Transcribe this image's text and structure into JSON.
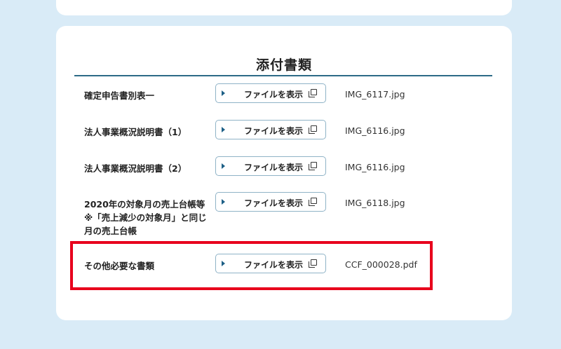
{
  "section": {
    "title": "添付書類"
  },
  "rows": [
    {
      "label": "確定申告書別表一",
      "button": "ファイルを表示",
      "file": "IMG_6117.jpg"
    },
    {
      "label": "法人事業概況説明書（1）",
      "button": "ファイルを表示",
      "file": "IMG_6116.jpg"
    },
    {
      "label": "法人事業概況説明書（2）",
      "button": "ファイルを表示",
      "file": "IMG_6116.jpg"
    },
    {
      "label_lines": [
        "2020年の対象月の売上台帳等",
        "※「売上減少の対象月」と同じ",
        "月の売上台帳"
      ],
      "button": "ファイルを表示",
      "file": "IMG_6118.jpg"
    },
    {
      "label": "その他必要な書類",
      "button": "ファイルを表示",
      "file": "CCF_000028.pdf"
    }
  ],
  "colors": {
    "background": "#d9ebf7",
    "accent": "#2c6a87",
    "highlight": "#e8001c"
  }
}
